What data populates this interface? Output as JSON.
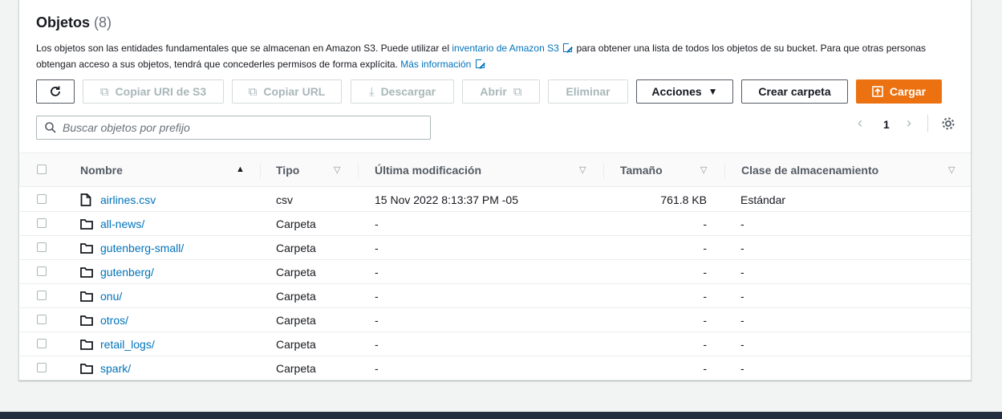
{
  "header": {
    "title": "Objetos",
    "count": "(8)",
    "desc_part1": "Los objetos son las entidades fundamentales que se almacenan en Amazon S3. Puede utilizar el ",
    "desc_link1": "inventario de Amazon S3",
    "desc_part2": " para obtener una lista de todos los objetos de su bucket. Para que otras personas obtengan acceso a sus objetos, tendrá que concederles permisos de forma explícita. ",
    "desc_link2": "Más información"
  },
  "toolbar": {
    "refresh_icon": "refresh-icon",
    "copy_s3_uri": "Copiar URI de S3",
    "copy_url": "Copiar URL",
    "download": "Descargar",
    "open": "Abrir",
    "delete": "Eliminar",
    "actions": "Acciones",
    "create_folder": "Crear carpeta",
    "upload": "Cargar"
  },
  "search": {
    "placeholder": "Buscar objetos por prefijo"
  },
  "pagination": {
    "current_page": "1"
  },
  "table": {
    "columns": [
      "Nombre",
      "Tipo",
      "Última modificación",
      "Tamaño",
      "Clase de almacenamiento"
    ],
    "rows": [
      {
        "name": "airlines.csv",
        "icon": "file-icon",
        "type": "csv",
        "modified": "15 Nov 2022 8:13:37 PM -05",
        "size": "761.8 KB",
        "storage": "Estándar"
      },
      {
        "name": "all-news/",
        "icon": "folder-icon",
        "type": "Carpeta",
        "modified": "-",
        "size": "-",
        "storage": "-"
      },
      {
        "name": "gutenberg-small/",
        "icon": "folder-icon",
        "type": "Carpeta",
        "modified": "-",
        "size": "-",
        "storage": "-"
      },
      {
        "name": "gutenberg/",
        "icon": "folder-icon",
        "type": "Carpeta",
        "modified": "-",
        "size": "-",
        "storage": "-"
      },
      {
        "name": "onu/",
        "icon": "folder-icon",
        "type": "Carpeta",
        "modified": "-",
        "size": "-",
        "storage": "-"
      },
      {
        "name": "otros/",
        "icon": "folder-icon",
        "type": "Carpeta",
        "modified": "-",
        "size": "-",
        "storage": "-"
      },
      {
        "name": "retail_logs/",
        "icon": "folder-icon",
        "type": "Carpeta",
        "modified": "-",
        "size": "-",
        "storage": "-"
      },
      {
        "name": "spark/",
        "icon": "folder-icon",
        "type": "Carpeta",
        "modified": "-",
        "size": "-",
        "storage": "-"
      }
    ]
  },
  "colors": {
    "link": "#0073bb",
    "primary": "#ec7211",
    "footer": "#232f3e"
  }
}
